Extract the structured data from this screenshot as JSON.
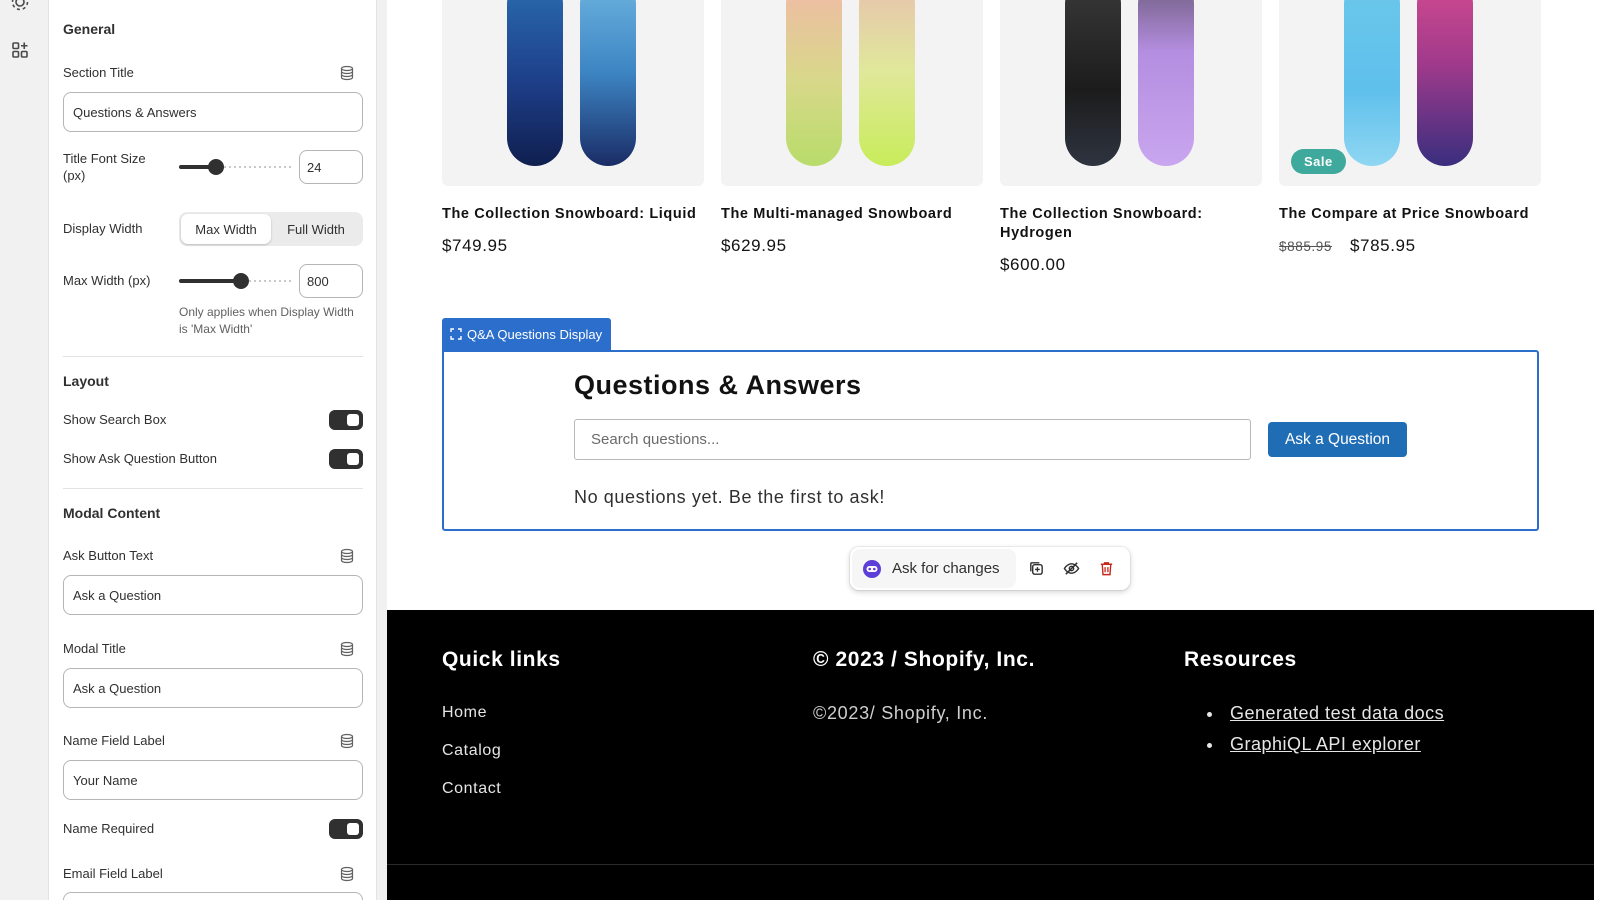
{
  "panel": {
    "general_heading": "General",
    "section_title_label": "Section Title",
    "section_title_value": "Questions & Answers",
    "title_font_size_label": "Title Font Size (px)",
    "title_font_size_value": "24",
    "title_font_size_level": 0.33,
    "display_width_label": "Display Width",
    "display_width_options": [
      "Max Width",
      "Full Width"
    ],
    "display_width_selected": "Max Width",
    "max_width_label": "Max Width (px)",
    "max_width_value": "800",
    "max_width_level": 0.55,
    "max_width_help": "Only applies when Display Width is 'Max Width'",
    "layout_heading": "Layout",
    "show_search_box_label": "Show Search Box",
    "show_search_box_on": true,
    "show_ask_button_label": "Show Ask Question Button",
    "show_ask_button_on": true,
    "modal_heading": "Modal Content",
    "ask_button_text_label": "Ask Button Text",
    "ask_button_text_value": "Ask a Question",
    "modal_title_label": "Modal Title",
    "modal_title_value": "Ask a Question",
    "name_field_label_label": "Name Field Label",
    "name_field_label_value": "Your Name",
    "name_required_label": "Name Required",
    "name_required_on": true,
    "email_field_label_label": "Email Field Label"
  },
  "products": [
    {
      "title": "The Collection Snowboard: Liquid",
      "price": "$749.95",
      "compare_price": "",
      "sale_badge": ""
    },
    {
      "title": "The Multi-managed Snowboard",
      "price": "$629.95",
      "compare_price": "",
      "sale_badge": ""
    },
    {
      "title": "The Collection Snowboard: Hydrogen",
      "price": "$600.00",
      "compare_price": "",
      "sale_badge": ""
    },
    {
      "title": "The Compare at Price Snowboard",
      "price": "$785.95",
      "compare_price": "$885.95",
      "sale_badge": "Sale"
    }
  ],
  "qa": {
    "tag_label": "Q&A Questions Display",
    "title": "Questions & Answers",
    "search_placeholder": "Search questions...",
    "ask_button": "Ask a Question",
    "empty_text": "No questions yet. Be the first to ask!"
  },
  "ai_bar": {
    "ask_label": "Ask for changes"
  },
  "footer": {
    "quick_links_heading": "Quick links",
    "quick_links": [
      "Home",
      "Catalog",
      "Contact"
    ],
    "copyright_heading": "© 2023 / Shopify, Inc.",
    "copyright_text": "©2023/ Shopify, Inc.",
    "resources_heading": "Resources",
    "resources": [
      "Generated test data docs",
      "GraphiQL API explorer"
    ]
  },
  "colors": {
    "accent_blue": "#2c6ecb",
    "button_blue": "#1f6db5",
    "sale_green": "#3ea99c",
    "footer_bg": "#000000",
    "delete_red": "#c5281c"
  }
}
